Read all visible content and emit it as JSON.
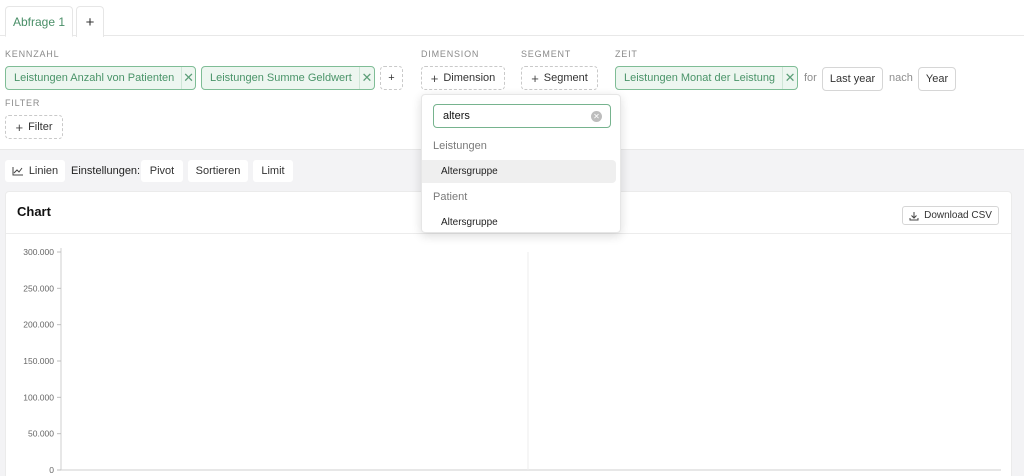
{
  "tabs": [
    {
      "label": "Abfrage 1"
    }
  ],
  "tab_add_label": "+",
  "sections": {
    "kennzahl": "KENNZAHL",
    "dimension": "DIMENSION",
    "segment": "SEGMENT",
    "zeit": "ZEIT",
    "filter": "FILTER"
  },
  "measures": [
    {
      "label": "Leistungen Anzahl von Patienten"
    },
    {
      "label": "Leistungen Summe Geldwert"
    }
  ],
  "add_measure_label": "+",
  "dimension_button": "Dimension",
  "segment_button": "Segment",
  "time": {
    "chip_label": "Leistungen Monat der Leistung",
    "for_label": "for",
    "range_value": "Last year",
    "nach_label": "nach",
    "granularity_value": "Year"
  },
  "filter_button": "Filter",
  "toolbar": {
    "chart_type": "Linien",
    "settings_label": "Einstellungen:",
    "pivot": "Pivot",
    "sort": "Sortieren",
    "limit": "Limit"
  },
  "chart_card": {
    "title": "Chart",
    "download_label": "Download CSV"
  },
  "dimension_dropdown": {
    "search_value": "alters",
    "groups": [
      {
        "name": "Leistungen",
        "options": [
          "Altersgruppe"
        ]
      },
      {
        "name": "Patient",
        "options": [
          "Altersgruppe"
        ]
      }
    ]
  },
  "colors": {
    "accent": "#4a8f68",
    "chip_bg": "#edf6f0",
    "chip_border": "#7fbd96"
  },
  "chart_data": {
    "type": "line",
    "y_ticks": [
      "300.000",
      "250.000",
      "200.000",
      "150.000",
      "100.000",
      "50.000",
      "0"
    ],
    "ylim": [
      0,
      300000
    ],
    "series": []
  }
}
